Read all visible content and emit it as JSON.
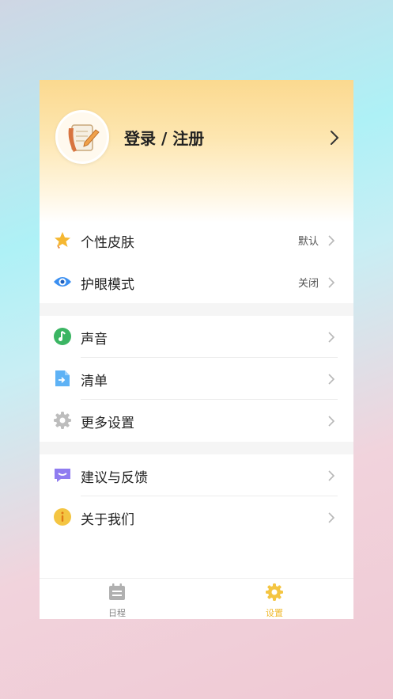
{
  "header": {
    "login_label": "登录 / 注册"
  },
  "group1": [
    {
      "label": "个性皮肤",
      "value": "默认",
      "icon": "star-sparkle-icon"
    },
    {
      "label": "护眼模式",
      "value": "关闭",
      "icon": "eye-icon"
    }
  ],
  "group2": [
    {
      "label": "声音",
      "icon": "music-note-icon"
    },
    {
      "label": "清单",
      "icon": "list-file-icon"
    },
    {
      "label": "更多设置",
      "icon": "gear-icon"
    }
  ],
  "group3": [
    {
      "label": "建议与反馈",
      "icon": "chat-bubble-icon"
    },
    {
      "label": "关于我们",
      "icon": "info-icon"
    }
  ],
  "tabbar": [
    {
      "label": "日程",
      "icon": "calendar-icon"
    },
    {
      "label": "设置",
      "icon": "settings-gear-icon"
    }
  ],
  "colors": {
    "accent": "#f4c542",
    "tab_inactive": "#b0b0b0"
  }
}
